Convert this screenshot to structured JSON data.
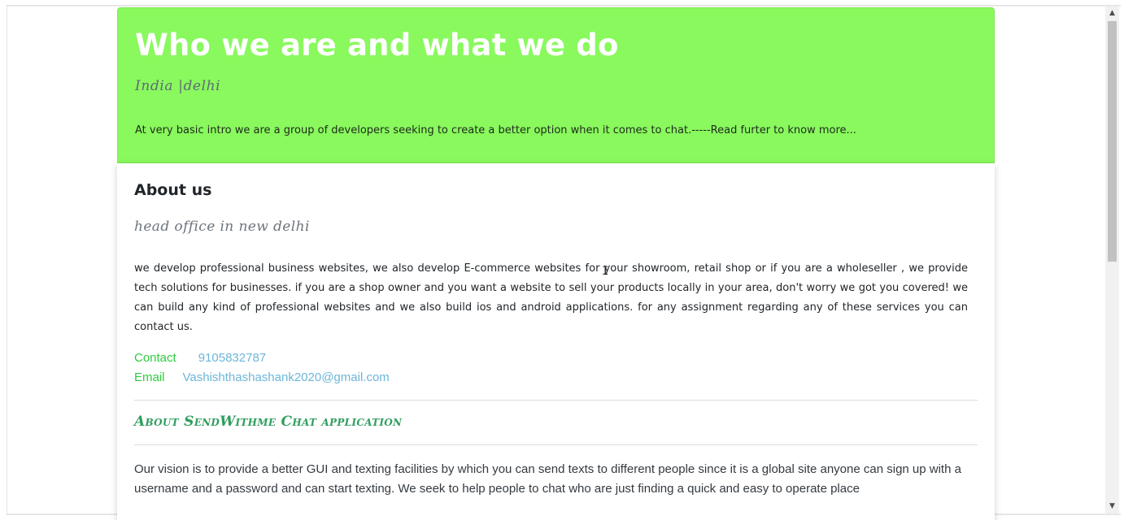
{
  "header": {
    "title": "Who we are and what we do",
    "subtitle": "India |delhi",
    "intro": "At very basic intro we are a group of developers seeking to create a better option when it comes to chat.-----Read furter to know more..."
  },
  "about": {
    "heading": "About us",
    "office": "head office in new delhi",
    "description": "we develop professional business websites, we also develop E-commerce websites for your showroom, retail shop or if you are a wholeseller , we provide tech solutions for businesses. if you are a shop owner and you want a website to sell your products locally in your area, don't worry we got you covered! we can build any kind of professional websites and we also build ios and android applications. for any assignment regarding any of these services you can contact us.",
    "contact_label": "Contact",
    "contact_value": "9105832787",
    "email_label": "Email",
    "email_value": "Vashishthashashank2020@gmail.com"
  },
  "app": {
    "title": "About SendWithme Chat application",
    "vision": "Our vision is to provide a better GUI and texting facilities by which you can send texts to different people since it is a global site anyone can sign up with a username and a password and can start texting. We seek to help people to chat who are just finding a quick and easy to operate place"
  },
  "scrollbar": {
    "up_arrow": "▲",
    "down_arrow": "▼"
  },
  "colors": {
    "header_bg": "#89f95e",
    "contact_label": "#2ecc40",
    "contact_value": "#6cb6d9",
    "app_title": "#2f9e5e"
  }
}
